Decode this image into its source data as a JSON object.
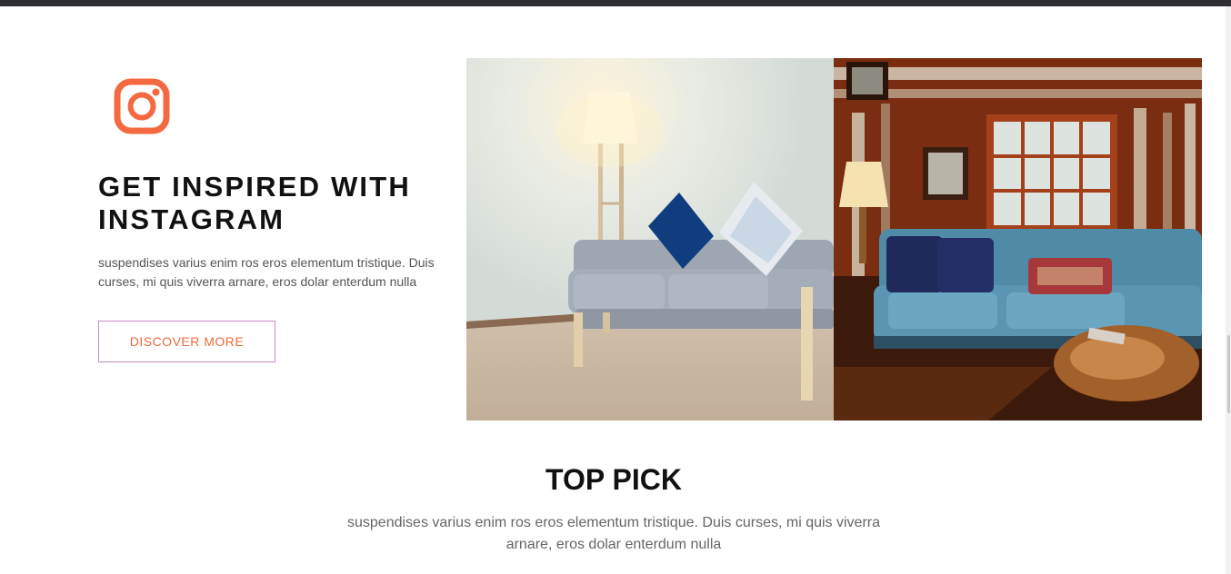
{
  "instagram_section": {
    "icon": "instagram-icon",
    "title": "GET INSPIRED WITH INSTAGRAM",
    "description": "suspendises varius enim ros eros elementum tristique. Duis curses, mi quis viverra arnare, eros dolar enterdum nulla",
    "button_label": "DISCOVER MORE",
    "accent_color": "#f4693f"
  },
  "gallery": {
    "images": [
      {
        "name": "living-room-grey-sofa-photo"
      },
      {
        "name": "cabin-blue-sofa-photo"
      }
    ]
  },
  "top_pick": {
    "title": "TOP PICK",
    "description": "suspendises varius enim ros eros elementum tristique. Duis curses, mi quis viverra arnare, eros dolar enterdum nulla"
  }
}
